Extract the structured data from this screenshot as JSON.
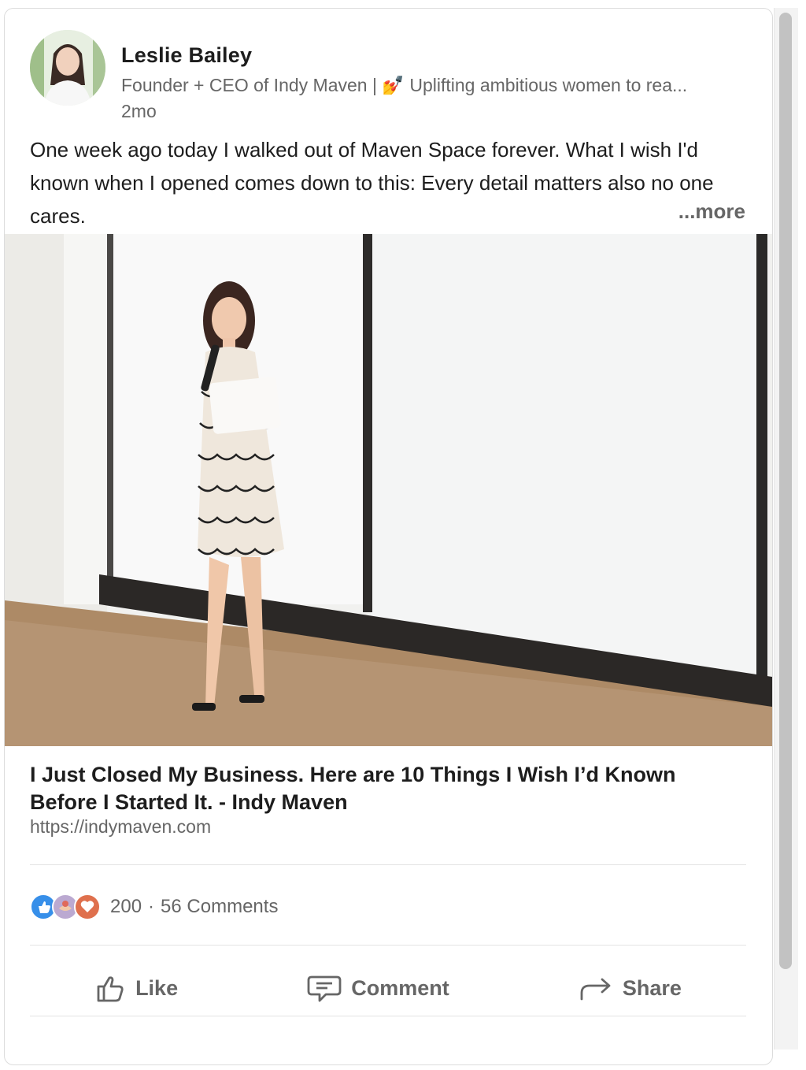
{
  "post": {
    "author_name": "Leslie Bailey",
    "author_headline": "Founder + CEO of Indy Maven | 💅 Uplifting ambitious women to rea...",
    "time_ago": "2mo",
    "text": "One week ago today I walked out of Maven Space forever. What I wish I'd known when I opened comes down to this: Every detail matters also no one cares.",
    "more_label": "...more"
  },
  "link_preview": {
    "title": "I Just Closed My Business. Here are 10 Things I Wish I’d Known Before I Started It. - Indy Maven",
    "url": "https://indymaven.com"
  },
  "social": {
    "reactions": [
      "like-icon",
      "support-icon",
      "love-icon"
    ],
    "reaction_count": "200",
    "separator": "·",
    "comments_label": "56 Comments"
  },
  "actions": {
    "like_label": "Like",
    "comment_label": "Comment",
    "share_label": "Share"
  },
  "colors": {
    "like_blue": "#378fe9",
    "love_orange": "#df704d",
    "support_purple": "#bba9d1",
    "muted_text": "#666666"
  }
}
